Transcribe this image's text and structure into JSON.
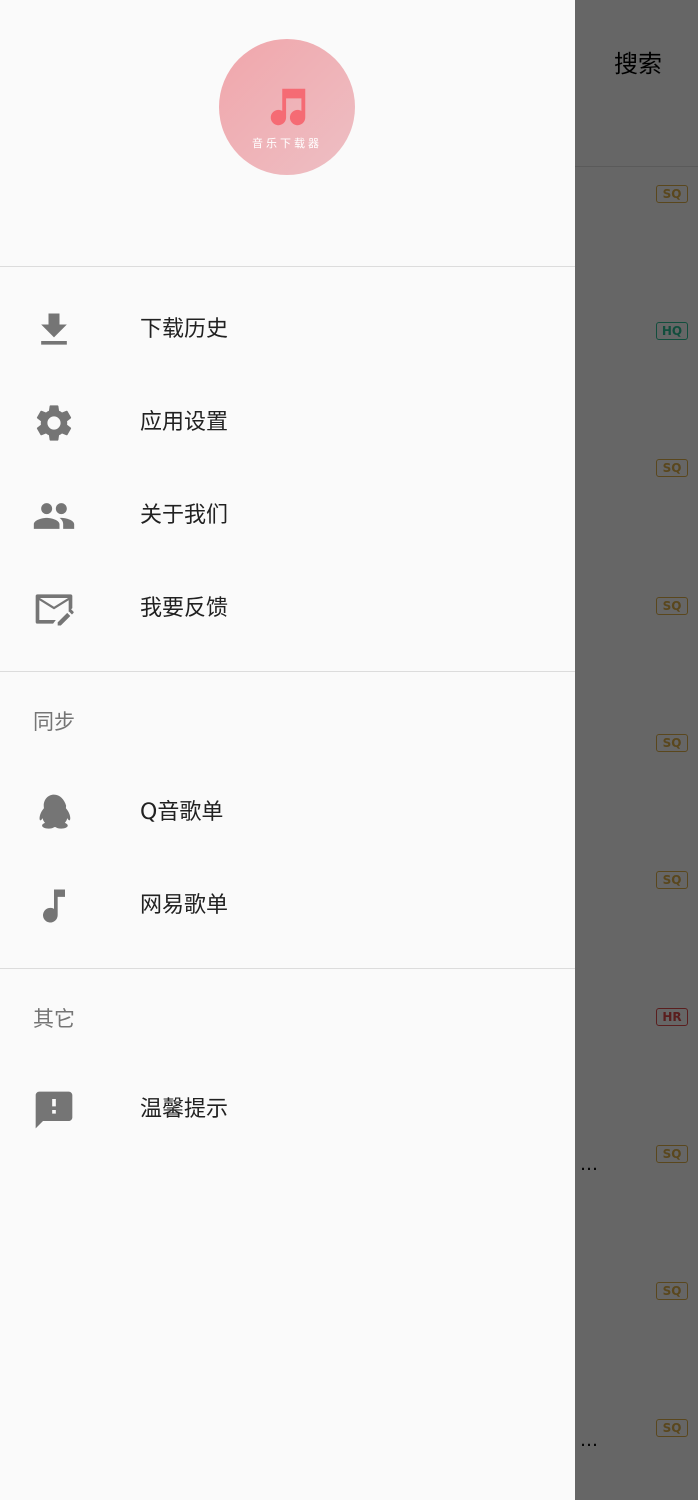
{
  "background_app": {
    "toolbar": {
      "search_label": "搜索"
    },
    "badges": [
      {
        "label": "SQ",
        "type": "sq"
      },
      {
        "label": "HQ",
        "type": "hq"
      },
      {
        "label": "SQ",
        "type": "sq"
      },
      {
        "label": "SQ",
        "type": "sq"
      },
      {
        "label": "SQ",
        "type": "sq"
      },
      {
        "label": "SQ",
        "type": "sq"
      },
      {
        "label": "HR",
        "type": "hr"
      },
      {
        "label": "SQ",
        "type": "sq"
      },
      {
        "label": "SQ",
        "type": "sq"
      },
      {
        "label": "SQ",
        "type": "sq"
      }
    ],
    "ellipsis": "…"
  },
  "drawer": {
    "logo_text": "音乐下载器",
    "main_items": [
      {
        "label": "下载历史",
        "icon": "download-icon"
      },
      {
        "label": "应用设置",
        "icon": "gear-icon"
      },
      {
        "label": "关于我们",
        "icon": "people-icon"
      },
      {
        "label": "我要反馈",
        "icon": "mail-edit-icon"
      }
    ],
    "sync_section": {
      "title": "同步",
      "items": [
        {
          "label": "Q音歌单",
          "icon": "qq-penguin-icon"
        },
        {
          "label": "网易歌单",
          "icon": "music-note-icon"
        }
      ]
    },
    "other_section": {
      "title": "其它",
      "items": [
        {
          "label": "温馨提示",
          "icon": "feedback-alert-icon"
        }
      ]
    }
  },
  "colors": {
    "icon": "#757575",
    "text": "#212121",
    "section_title": "#757575",
    "logo_gradient_start": "#f0a6ab",
    "badge_sq": "#e0b14a",
    "badge_hq": "#2fc39a",
    "badge_hr": "#e14b4b"
  }
}
